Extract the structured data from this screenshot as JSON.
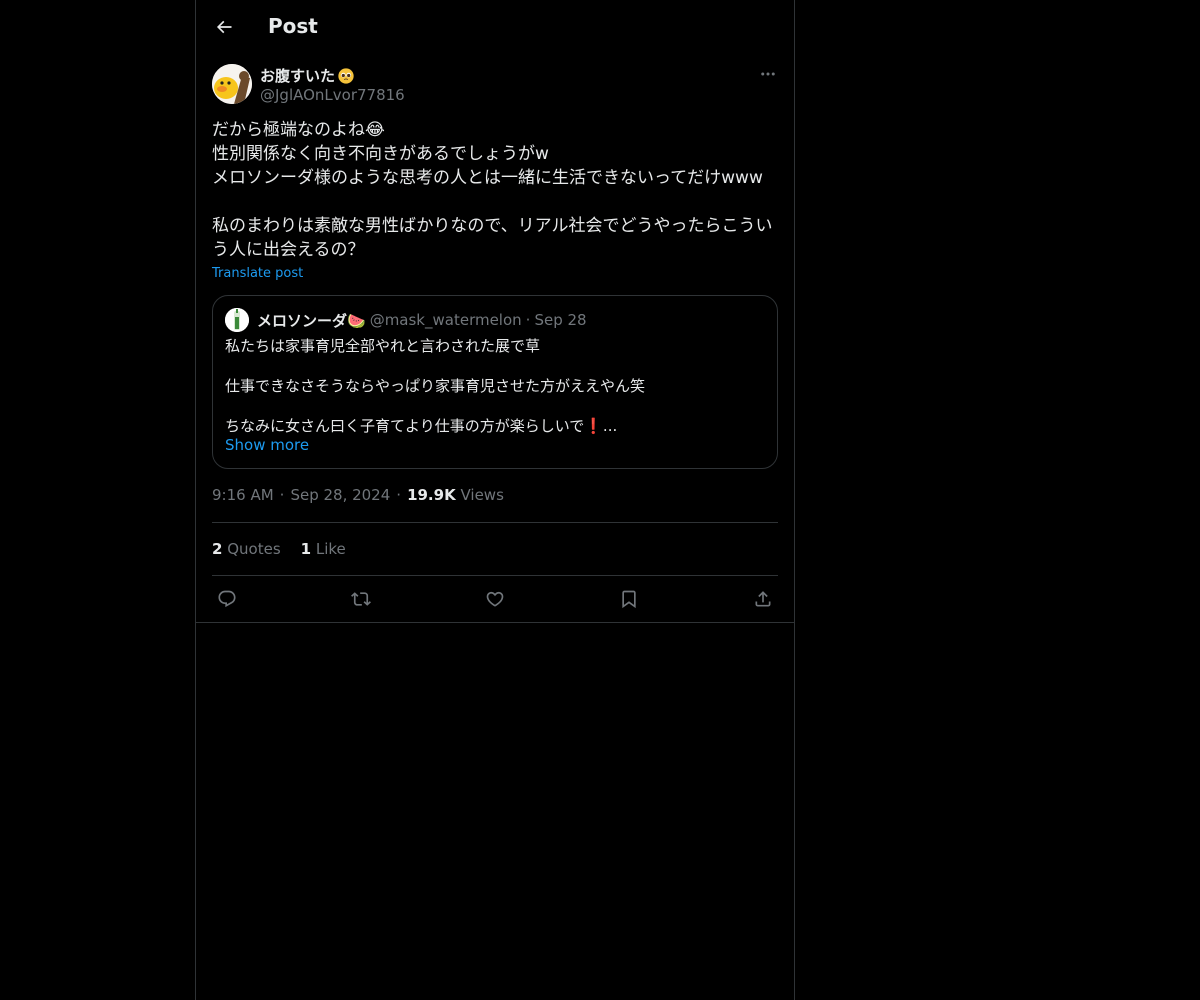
{
  "header": {
    "title": "Post",
    "back_icon": "arrow-left-icon"
  },
  "post": {
    "author_name": "お腹すいた",
    "author_emoji": "pleading-face-emoji",
    "author_handle": "@JglAOnLvor77816",
    "body_lines": [
      "だから極端なのよね😂",
      "性別関係なく向き不向きがあるでしょうがw",
      "メロソンーダ様のような思考の人とは一緒に生活できないってだけwww",
      "",
      "私のまわりは素敵な男性ばかりなので、リアル社会でどうやったらこうい",
      "う人に出会えるの？"
    ],
    "translate_label": "Translate post",
    "time": "9:16 AM",
    "date": "Sep 28, 2024",
    "views_count": "19.9K",
    "views_label": "Views",
    "meta_dot": "·"
  },
  "quote": {
    "name": "メロソンーダ🍉",
    "handle": "@mask_watermelon",
    "dot": "·",
    "date": "Sep 28",
    "lines": [
      "私たちは家事育児全部やれと言わされた展で草",
      "",
      "仕事できなさそうならやっぱり家事育児させた方がええやん笑",
      "",
      "ちなみに女さん曰く子育てより仕事の方が楽らしいで❗..."
    ],
    "show_more": "Show more"
  },
  "stats": {
    "quotes_count": "2",
    "quotes_label": "Quotes",
    "likes_count": "1",
    "likes_label": "Like"
  },
  "actions": [
    "reply-icon",
    "repost-icon",
    "like-icon",
    "bookmark-icon",
    "share-icon"
  ],
  "colors": {
    "background": "#000000",
    "text": "#e7e9ea",
    "secondary": "#71767b",
    "link": "#1d9bf0",
    "border": "#2f3336"
  }
}
